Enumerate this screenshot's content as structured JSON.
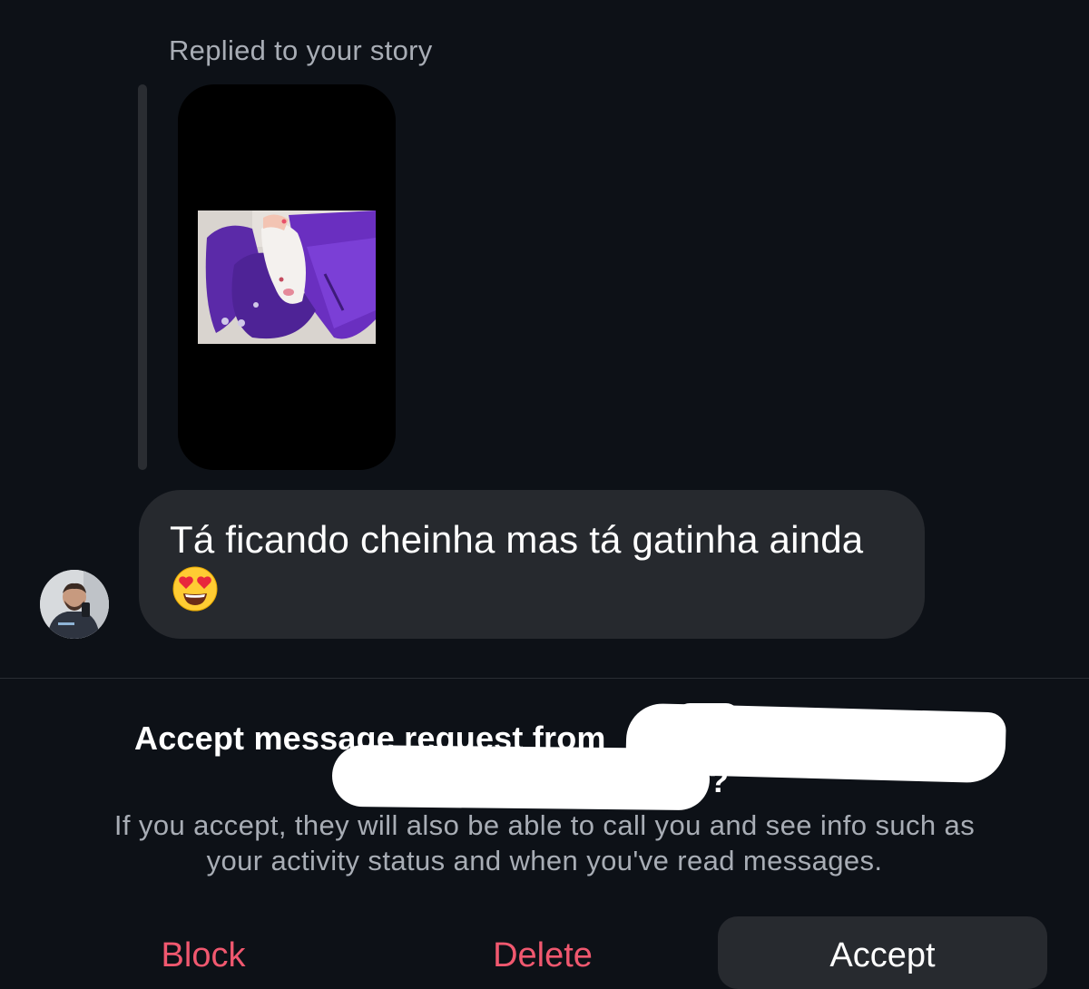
{
  "story_reply": {
    "label": "Replied to your story",
    "story_image": "story-photo-purple-jacket-white-cat"
  },
  "message": {
    "text": "Tá ficando cheinha mas tá gatinha ainda",
    "emoji": "heart-eyes-emoji",
    "sender_avatar": "avatar"
  },
  "request": {
    "title_prefix": "Accept message request from",
    "title_suffix": "?",
    "info_line1": "If you accept, they will also be able to call you and see info such as",
    "info_line2": "your activity status and when you've read messages."
  },
  "actions": {
    "block_label": "Block",
    "delete_label": "Delete",
    "accept_label": "Accept"
  },
  "colors": {
    "background": "#0d1117",
    "bubble": "#26292e",
    "destructive": "#f0586f",
    "secondary_text": "#a8adb5"
  }
}
